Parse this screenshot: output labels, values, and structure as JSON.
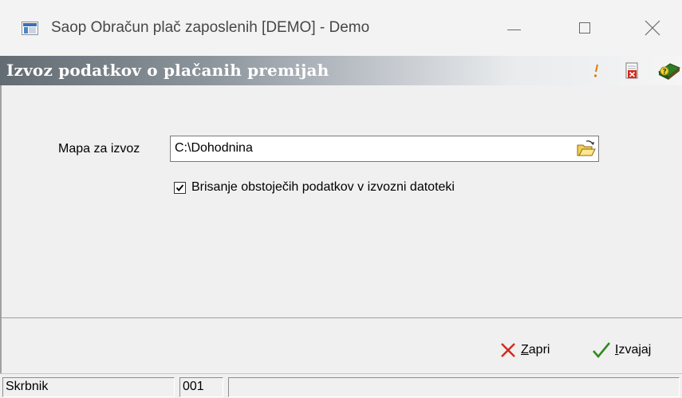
{
  "window": {
    "title": "Saop Obračun plač zaposlenih [DEMO] - Demo",
    "app_icon": "application-window-icon",
    "controls": {
      "minimize_icon": "minimize-icon",
      "maximize_icon": "maximize-icon",
      "close_icon": "close-icon"
    }
  },
  "dialog": {
    "title": "Izvoz podatkov o plačanih premijah",
    "header_icons": [
      "pin-icon",
      "document-delete-icon",
      "help-book-icon"
    ]
  },
  "form": {
    "folder_label": "Mapa za izvoz",
    "folder_value": "C:\\Dohodnina",
    "browse_icon": "open-folder-icon",
    "delete_checkbox_label": "Brisanje obstoječih podatkov v izvozni datoteki",
    "delete_checkbox_checked": true
  },
  "buttons": {
    "close_accel": "Z",
    "close_rest": "apri",
    "close_icon": "red-x-icon",
    "run_accel": "I",
    "run_rest": "zvajaj",
    "run_icon": "green-check-icon"
  },
  "statusbar": {
    "user": "Skrbnik",
    "code": "001",
    "message": ""
  },
  "colors": {
    "header_gradient_start": "#636b73",
    "close_x": "#d42a1a",
    "check": "#2e8b1e",
    "window_bg": "#f0f0f0"
  }
}
